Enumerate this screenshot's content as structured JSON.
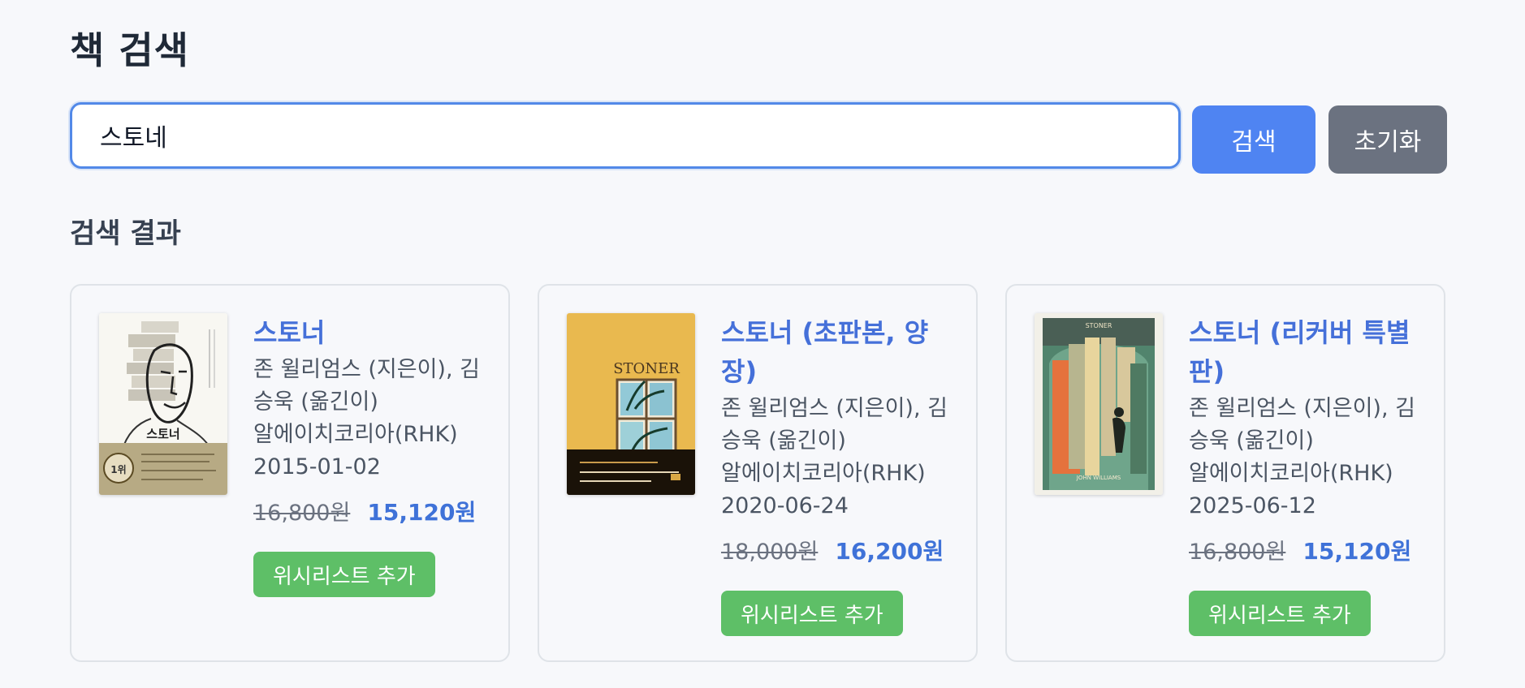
{
  "page": {
    "title": "책 검색",
    "results_title": "검색 결과"
  },
  "search": {
    "value": "스토네",
    "search_label": "검색",
    "reset_label": "초기화"
  },
  "books": [
    {
      "title": "스토너",
      "authors": "존 윌리엄스 (지은이), 김승욱 (옮긴이)",
      "publisher": "알에이치코리아(RHK)",
      "date": "2015-01-02",
      "original_price": "16,800원",
      "sale_price": "15,120원",
      "wishlist_label": "위시리스트 추가",
      "cover_title": "스토너",
      "cover_badge": "1위"
    },
    {
      "title": "스토너 (초판본, 양장)",
      "authors": "존 윌리엄스 (지은이), 김승욱 (옮긴이)",
      "publisher": "알에이치코리아(RHK)",
      "date": "2020-06-24",
      "original_price": "18,000원",
      "sale_price": "16,200원",
      "wishlist_label": "위시리스트 추가",
      "cover_title": "STONER"
    },
    {
      "title": "스토너 (리커버 특별판)",
      "authors": "존 윌리엄스 (지은이), 김승욱 (옮긴이)",
      "publisher": "알에이치코리아(RHK)",
      "date": "2025-06-12",
      "original_price": "16,800원",
      "sale_price": "15,120원",
      "wishlist_label": "위시리스트 추가",
      "cover_title": "STONER",
      "cover_author": "JOHN WILLIAMS"
    }
  ],
  "colors": {
    "background": "#f7f8fb",
    "search_border": "#5289e8",
    "search_button": "#4f84f2",
    "reset_button": "#6b7280",
    "title_link": "#4570d9",
    "sale_price": "#3f72d8",
    "wishlist_button": "#5ebf67"
  }
}
